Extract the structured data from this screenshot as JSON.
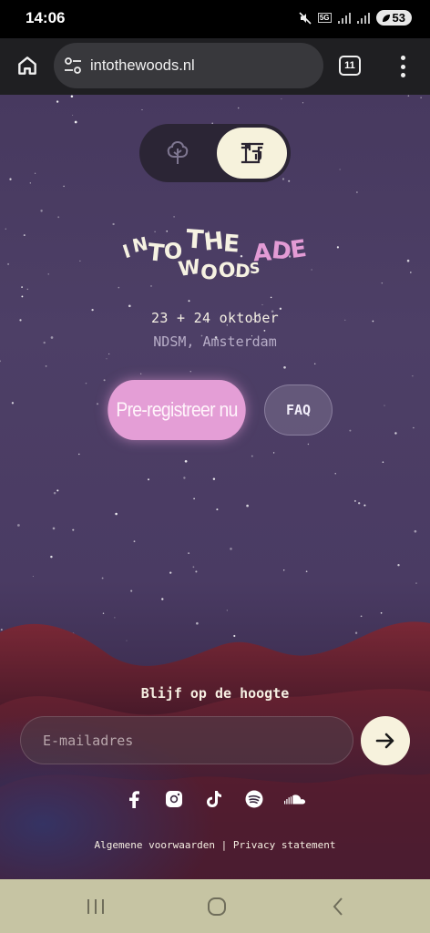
{
  "status_bar": {
    "time": "14:06",
    "network": "5G",
    "battery": "53"
  },
  "browser": {
    "url": "intothewoods.nl",
    "tab_count": "11"
  },
  "page": {
    "toggle": {
      "options": [
        "tree",
        "city"
      ],
      "selected": "city"
    },
    "logo": {
      "words": [
        "INTO",
        "THE",
        "WOODS",
        "ADE"
      ]
    },
    "event": {
      "date": "23 + 24 oktober",
      "venue": "NDSM, Amsterdam"
    },
    "buttons": {
      "preregister": "Pre-registreer nu",
      "faq": "FAQ"
    },
    "newsletter": {
      "label": "Blijf op de hoogte",
      "placeholder": "E-mailadres"
    },
    "socials": [
      "facebook-icon",
      "instagram-icon",
      "tiktok-icon",
      "spotify-icon",
      "soundcloud-icon"
    ],
    "footer": {
      "terms": "Algemene voorwaarden",
      "separator": " | ",
      "privacy": "Privacy statement"
    }
  },
  "colors": {
    "background_top": "#47395f",
    "accent_pink": "#e49ed6",
    "cream": "#f6f2dc",
    "hills": "#6e2230"
  }
}
